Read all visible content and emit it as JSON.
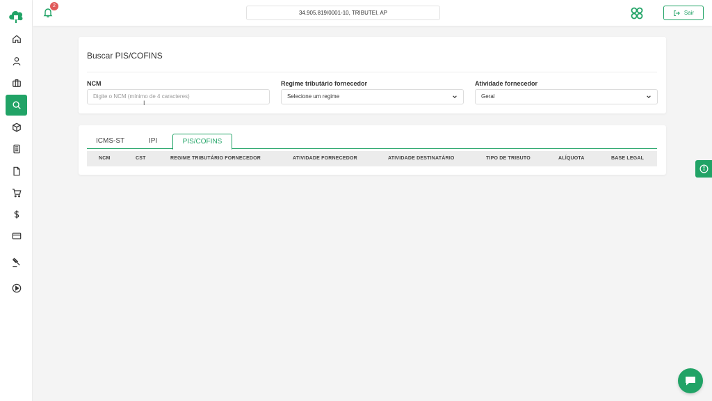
{
  "notifications": {
    "count": "2"
  },
  "company": {
    "label": "34.905.819/0001-10, TRIBUTEI, AP"
  },
  "logout": {
    "label": "Sair"
  },
  "search_card": {
    "title": "Buscar PIS/COFINS",
    "ncm": {
      "label": "NCM",
      "placeholder": "Digite o NCM (mínimo de 4 caracteres)"
    },
    "regime": {
      "label": "Regime tributário fornecedor",
      "value": "Selecione um regime"
    },
    "atividade": {
      "label": "Atividade fornecedor",
      "value": "Geral"
    }
  },
  "tabs": [
    {
      "label": "ICMS-ST"
    },
    {
      "label": "IPI"
    },
    {
      "label": "PIS/COFINS"
    }
  ],
  "active_tab": "PIS/COFINS",
  "table": {
    "columns": [
      "NCM",
      "CST",
      "REGIME TRIBUTÁRIO FORNECEDOR",
      "ATIVIDADE FORNECEDOR",
      "ATIVIDADE DESTINATÁRIO",
      "TIPO DE TRIBUTO",
      "ALÍQUOTA",
      "BASE LEGAL"
    ],
    "rows": []
  },
  "colors": {
    "accent": "#21a366",
    "badge": "#e05a5a",
    "background": "#f4f4f4"
  },
  "sidebar": {
    "items": [
      {
        "icon": "home-icon"
      },
      {
        "icon": "user-icon"
      },
      {
        "icon": "briefcase-icon"
      },
      {
        "icon": "search-icon"
      },
      {
        "icon": "box-icon"
      },
      {
        "icon": "calculator-icon"
      },
      {
        "icon": "file-icon"
      },
      {
        "icon": "cart-icon"
      },
      {
        "icon": "dollar-icon"
      },
      {
        "icon": "credit-card-icon"
      },
      {
        "icon": "gavel-icon"
      },
      {
        "icon": "play-circle-icon"
      }
    ],
    "active_icon": "search-icon"
  }
}
